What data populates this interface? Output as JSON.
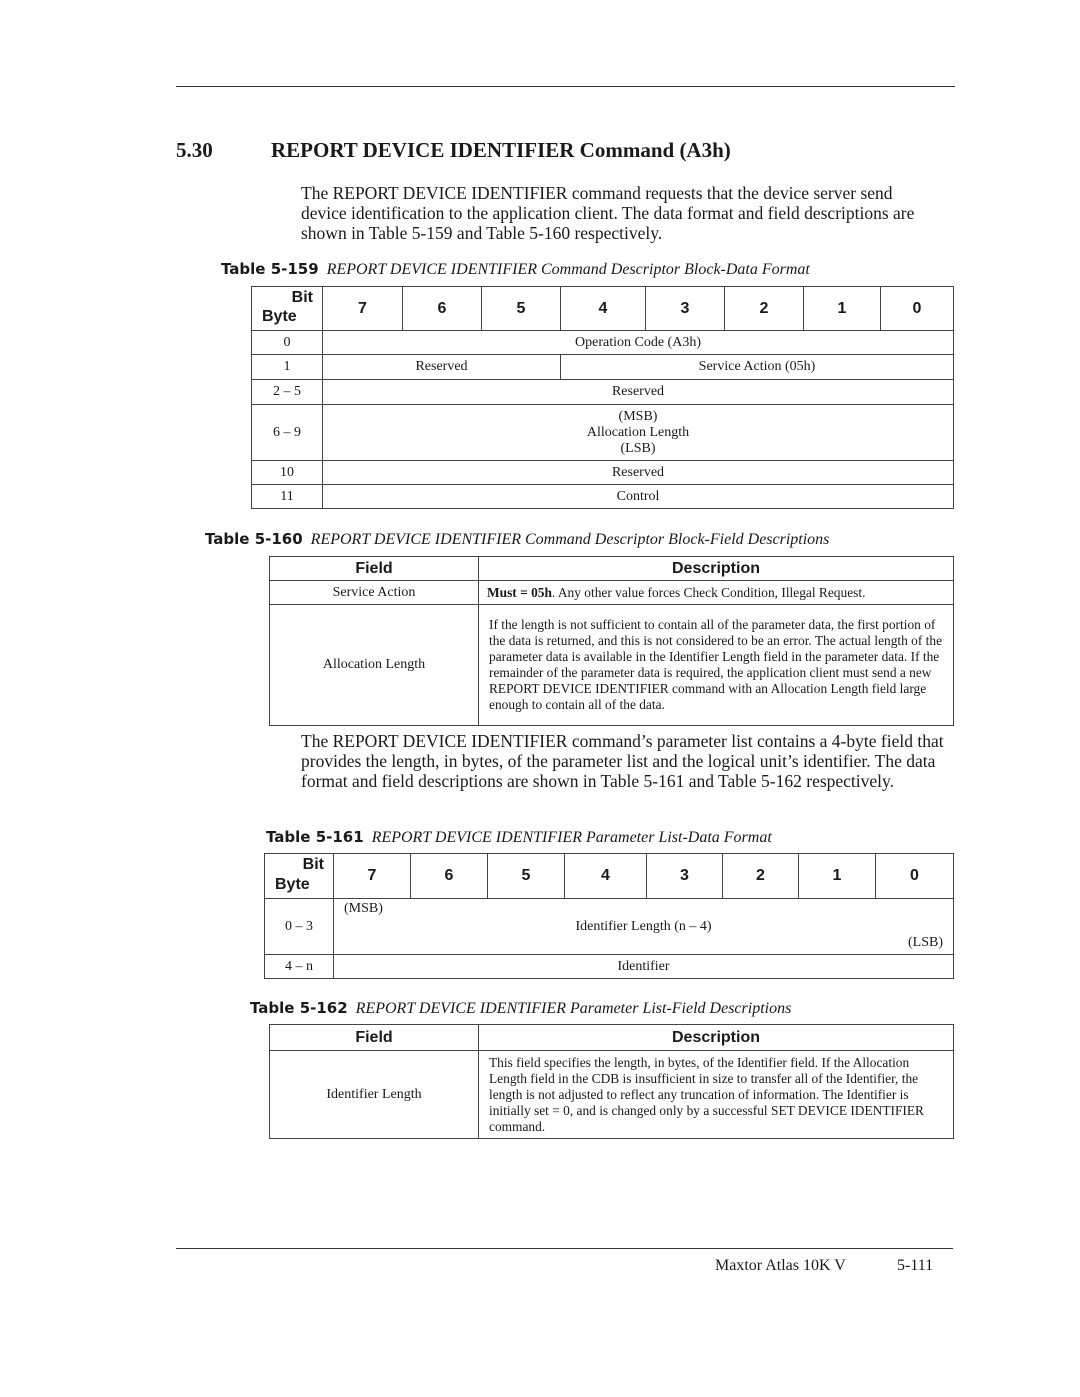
{
  "section": {
    "number": "5.30",
    "title": "REPORT DEVICE IDENTIFIER Command (A3h)",
    "intro": "The REPORT DEVICE IDENTIFIER command requests that the device server send device identification to the application client. The data format and field descriptions are shown in Table 5-159 and Table 5-160 respectively."
  },
  "table159": {
    "label": "Table 5-159",
    "title": "REPORT DEVICE IDENTIFIER Command Descriptor Block-Data Format",
    "corner_bit": "Bit",
    "corner_byte": "Byte",
    "bits": [
      "7",
      "6",
      "5",
      "4",
      "3",
      "2",
      "1",
      "0"
    ],
    "rows": [
      {
        "byte": "0",
        "content": "Operation Code (A3h)"
      },
      {
        "byte": "1",
        "left": "Reserved",
        "right": "Service Action (05h)"
      },
      {
        "byte": "2 – 5",
        "content": "Reserved"
      },
      {
        "byte": "6 – 9",
        "msb": "(MSB)",
        "content": "Allocation Length",
        "lsb": "(LSB)"
      },
      {
        "byte": "10",
        "content": "Reserved"
      },
      {
        "byte": "11",
        "content": "Control"
      }
    ]
  },
  "table160": {
    "label": "Table 5-160",
    "title": "REPORT DEVICE IDENTIFIER Command Descriptor Block-Field Descriptions",
    "headers": [
      "Field",
      "Description"
    ],
    "rows": [
      {
        "field": "Service Action",
        "desc_bold": "Must = 05h",
        "desc": ". Any other value forces Check Condition, Illegal Request."
      },
      {
        "field": "Allocation Length",
        "desc": "If the length is not sufficient to contain all of the parameter data, the first portion of the data is returned, and this is not considered to be an error. The actual length of the parameter data is available in the Identifier Length field in the parameter data. If the remainder of the parameter data is required, the application client must send a new REPORT DEVICE IDENTIFIER command with an Allocation Length field large enough to contain all of the data."
      }
    ]
  },
  "para2": "The REPORT DEVICE IDENTIFIER command’s parameter list contains a 4-byte field that provides the length, in bytes, of the parameter list and the logical unit’s identifier. The data format and field descriptions are shown in Table 5-161 and Table 5-162 respectively.",
  "table161": {
    "label": "Table 5-161",
    "title": "REPORT DEVICE IDENTIFIER Parameter List-Data Format",
    "corner_bit": "Bit",
    "corner_byte": "Byte",
    "bits": [
      "7",
      "6",
      "5",
      "4",
      "3",
      "2",
      "1",
      "0"
    ],
    "rows": [
      {
        "byte": "0 – 3",
        "msb": "(MSB)",
        "content": "Identifier Length (n – 4)",
        "lsb": "(LSB)"
      },
      {
        "byte": "4 – n",
        "content": "Identifier"
      }
    ]
  },
  "table162": {
    "label": "Table 5-162",
    "title": "REPORT DEVICE IDENTIFIER Parameter List-Field Descriptions",
    "headers": [
      "Field",
      "Description"
    ],
    "rows": [
      {
        "field": "Identifier Length",
        "desc": "This field specifies the length, in bytes, of the Identifier field. If the Allocation Length field in the CDB is insufficient in size to transfer all of the Identifier, the length is not adjusted to reflect any truncation of information. The Identifier is initially set = 0, and is changed only by a successful SET DEVICE IDENTIFIER command."
      }
    ]
  },
  "footer": {
    "product": "Maxtor Atlas 10K V",
    "page": "5-111"
  }
}
